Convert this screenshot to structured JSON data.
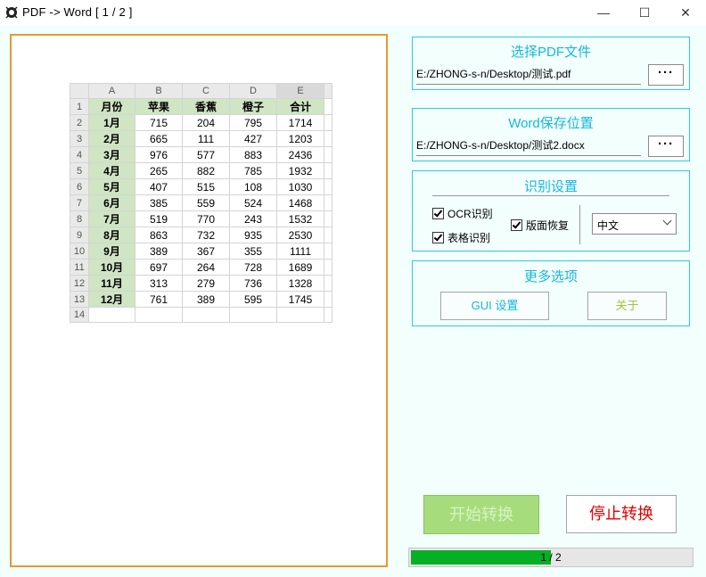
{
  "window": {
    "title": "PDF -> Word  [ 1 / 2 ]",
    "minimize": "—",
    "maximize": "☐",
    "close": "✕"
  },
  "preview": {
    "col_headers": [
      "A",
      "B",
      "C",
      "D",
      "E"
    ],
    "header_row": [
      "月份",
      "苹果",
      "香蕉",
      "橙子",
      "合计"
    ],
    "rows": [
      [
        "1月",
        "715",
        "204",
        "795",
        "1714"
      ],
      [
        "2月",
        "665",
        "111",
        "427",
        "1203"
      ],
      [
        "3月",
        "976",
        "577",
        "883",
        "2436"
      ],
      [
        "4月",
        "265",
        "882",
        "785",
        "1932"
      ],
      [
        "5月",
        "407",
        "515",
        "108",
        "1030"
      ],
      [
        "6月",
        "385",
        "559",
        "524",
        "1468"
      ],
      [
        "7月",
        "519",
        "770",
        "243",
        "1532"
      ],
      [
        "8月",
        "863",
        "732",
        "935",
        "2530"
      ],
      [
        "9月",
        "389",
        "367",
        "355",
        "1111"
      ],
      [
        "10月",
        "697",
        "264",
        "728",
        "1689"
      ],
      [
        "11月",
        "313",
        "279",
        "736",
        "1328"
      ],
      [
        "12月",
        "761",
        "389",
        "595",
        "1745"
      ]
    ],
    "row_numbers": [
      "1",
      "2",
      "3",
      "4",
      "5",
      "6",
      "7",
      "8",
      "9",
      "10",
      "11",
      "12",
      "13",
      "14"
    ]
  },
  "pdf_panel": {
    "title": "选择PDF文件",
    "path": "E:/ZHONG-s-n/Desktop/测试.pdf",
    "browse_label": "···"
  },
  "word_panel": {
    "title": "Word保存位置",
    "path": "E:/ZHONG-s-n/Desktop/测试2.docx",
    "browse_label": "···"
  },
  "recog_panel": {
    "title": "识别设置",
    "ocr_label": "OCR识别",
    "table_label": "表格识别",
    "layout_label": "版面恢复",
    "language_value": "中文"
  },
  "more_panel": {
    "title": "更多选项",
    "gui_button": "GUI 设置",
    "about_button": "关于"
  },
  "actions": {
    "start": "开始转换",
    "stop": "停止转换"
  },
  "progress": {
    "text": "1 / 2",
    "fraction": 0.5
  },
  "colors": {
    "accent": "#2ec9e2",
    "panel_title": "#17b7dc",
    "preview_border": "#e79a2e",
    "start_bg": "#a7dc7c",
    "stop_text": "#e30000",
    "progress_fill": "#06b025"
  }
}
